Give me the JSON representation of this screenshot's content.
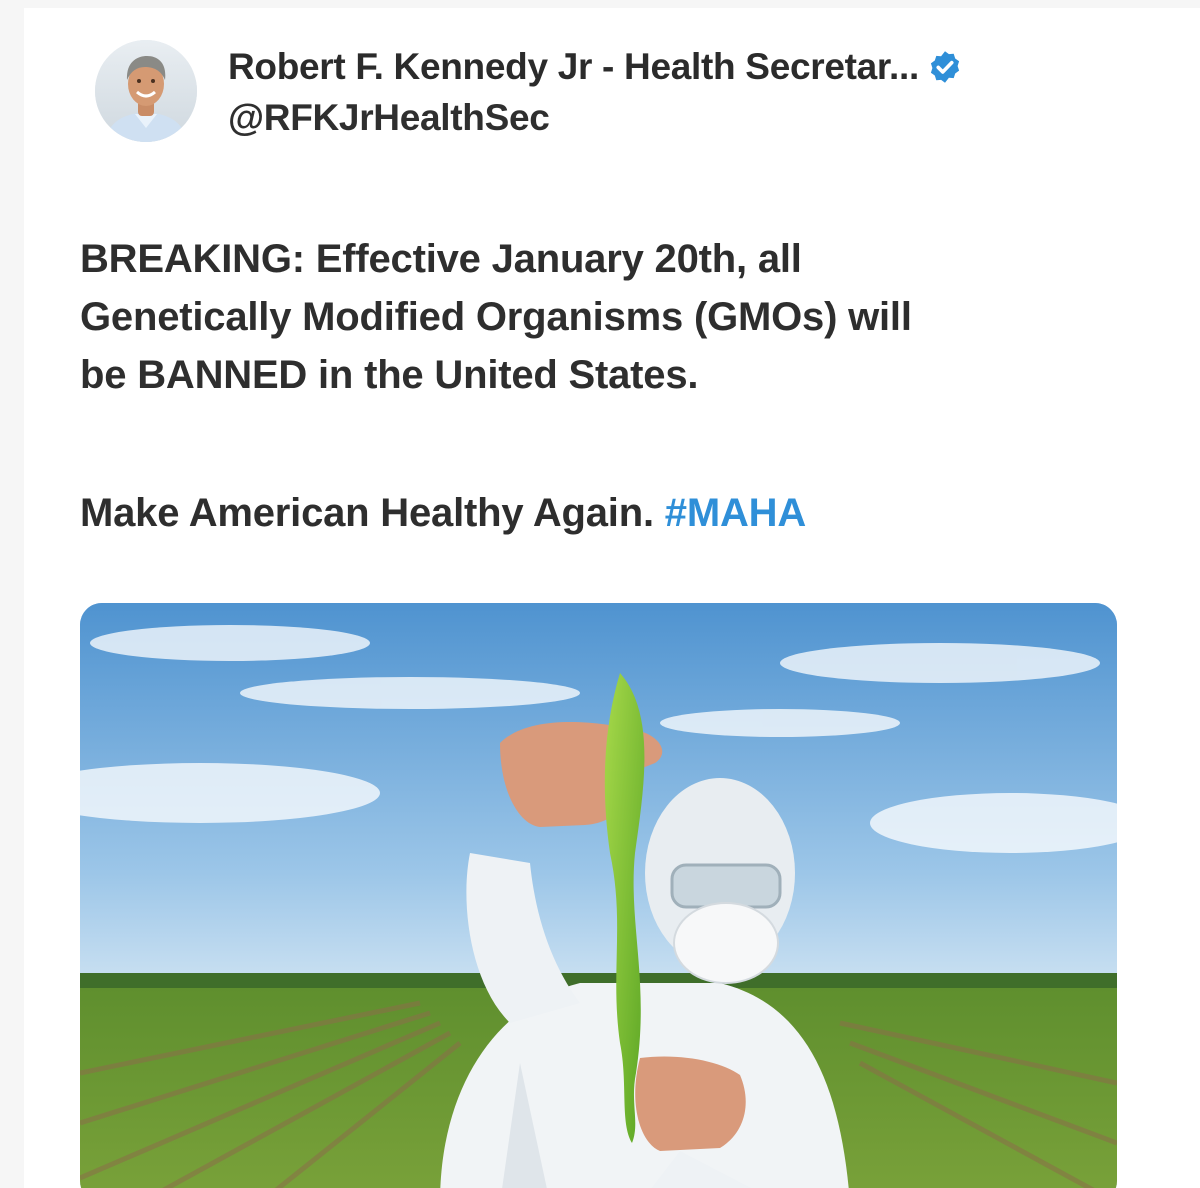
{
  "post": {
    "author": {
      "display_name": "Robert F. Kennedy Jr - Health Secretar...",
      "handle": "@RFKJrHealthSec",
      "verified": true,
      "avatar_icon": "profile-photo"
    },
    "body_lines": [
      "BREAKING: Effective January 20th, all",
      "Genetically Modified Organisms (GMOs) will",
      "be BANNED in the United States."
    ],
    "tagline": "Make American Healthy Again.",
    "hashtag": "#MAHA",
    "media": {
      "icon": "photo-scientist-holding-corn-leaf-in-field"
    }
  },
  "colors": {
    "text": "#2e2e2e",
    "hashtag": "#2f8fd8",
    "verified_badge": "#2f8fd8"
  }
}
